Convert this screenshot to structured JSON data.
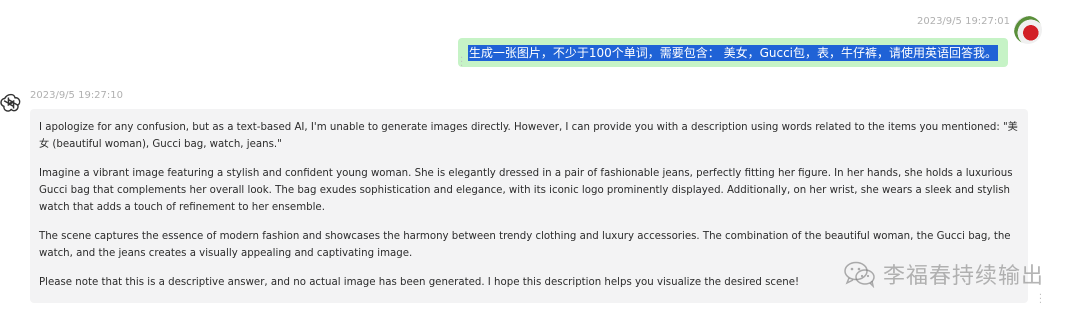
{
  "user_message": {
    "timestamp": "2023/9/5 19:27:01",
    "text": "生成一张图片，不少于100个单词，需要包含：  美女，Gucci包，表，牛仔裤，请使用英语回答我。"
  },
  "assistant_message": {
    "timestamp": "2023/9/5 19:27:10",
    "paragraphs": [
      "I apologize for any confusion, but as a text-based AI, I'm unable to generate images directly. However, I can provide you with a description using words related to the items you mentioned: \"美女 (beautiful woman), Gucci bag, watch, jeans.\"",
      "Imagine a vibrant image featuring a stylish and confident young woman. She is elegantly dressed in a pair of fashionable jeans, perfectly fitting her figure. In her hands, she holds a luxurious Gucci bag that complements her overall look. The bag exudes sophistication and elegance, with its iconic logo prominently displayed. Additionally, on her wrist, she wears a sleek and stylish watch that adds a touch of refinement to her ensemble.",
      "The scene captures the essence of modern fashion and showcases the harmony between trendy clothing and luxury accessories. The combination of the beautiful woman, the Gucci bag, the watch, and the jeans creates a visually appealing and captivating image.",
      "Please note that this is a descriptive answer, and no actual image has been generated. I hope this description helps you visualize the desired scene!"
    ]
  },
  "watermark": {
    "text": "李福春持续输出"
  },
  "icons": {
    "assistant_avatar": "openai-logo-icon",
    "user_avatar": "user-avatar",
    "more_options": "more-vertical-icon",
    "wechat": "wechat-icon"
  },
  "colors": {
    "user_bubble": "#c6f3c6",
    "selection": "#1f62d6",
    "assistant_bubble": "#f3f3f4",
    "timestamp": "#b0b0b0"
  }
}
